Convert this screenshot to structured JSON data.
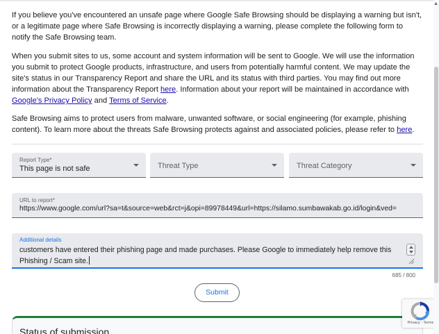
{
  "intro": {
    "paragraph1": "If you believe you've encountered an unsafe page where Google Safe Browsing should be displaying a warning but isn't, or a legitimate page where Safe Browsing is incorrectly displaying a warning, please complete the following form to notify the Safe Browsing team.",
    "paragraph2": {
      "text1": "When you submit sites to us, some account and system information will be sent to Google. We will use the information you submit to protect Google products, infrastructure, and users from potentially harmful content. We may update the site's status in our Transparency Report and share the URL and its status with third parties. You may find out more information about the Transparency Report ",
      "link_here": "here",
      "text2": ". Information about your report will be maintained in accordance with ",
      "link_privacy": "Google's Privacy Policy",
      "text3": " and ",
      "link_terms": "Terms of Service",
      "text4": "."
    },
    "paragraph3": {
      "text1": "Safe Browsing aims to protect users from malware, unwanted software, or social engineering (for example, phishing content). To learn more about the threats Safe Browsing protects against and associated policies, please refer to ",
      "link_here": "here",
      "text2": "."
    }
  },
  "form": {
    "report_type": {
      "label": "Report Type*",
      "value": "This page is not safe"
    },
    "threat_type": {
      "placeholder": "Threat Type"
    },
    "threat_category": {
      "placeholder": "Threat Category"
    },
    "url": {
      "label": "URL to report*",
      "value": "https://www.google.com/url?sa=t&source=web&rct=j&opi=89978449&url=https://silamo.sumbawakab.go.id/login&ved="
    },
    "details": {
      "label": "Additional details",
      "value": "customers have entered their phishing page and made purchases. Please Google to immediately help remove this Phishing / Scam site.",
      "counter": "685 / 800"
    },
    "submit_label": "Submit"
  },
  "status": {
    "title": "Status of submission"
  },
  "recaptcha": {
    "links": "Privacy - Terms"
  },
  "colors": {
    "link": "#1a0dab",
    "accent": "#1a73e8",
    "status_green": "#188038"
  }
}
